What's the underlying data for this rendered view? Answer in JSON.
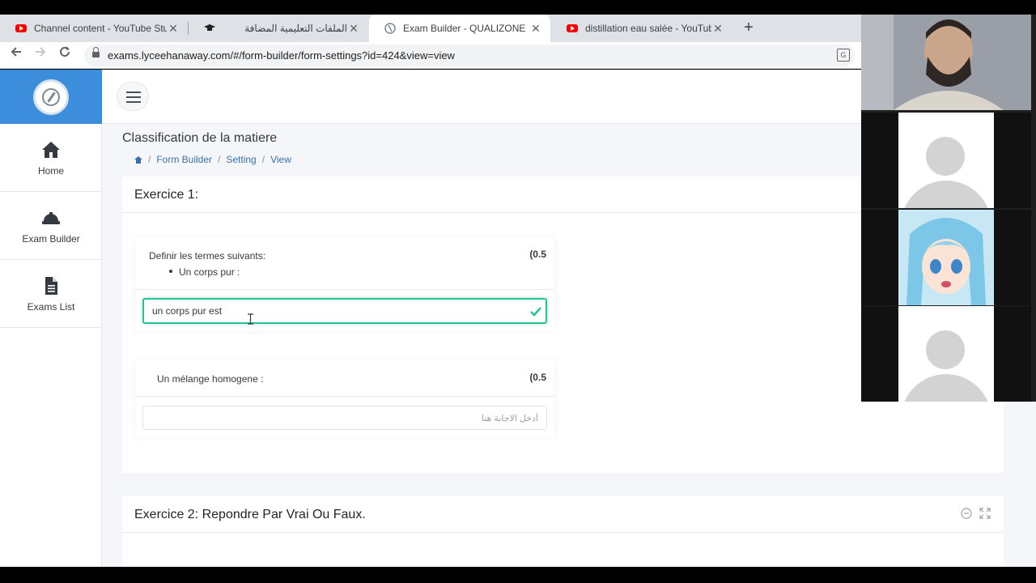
{
  "browser": {
    "tabs": [
      {
        "label": "Channel content - YouTube Studio",
        "icon": "youtube-icon",
        "active": false
      },
      {
        "label": "الملفات التعليمية المضافة",
        "icon": "graduation-cap-icon",
        "active": false
      },
      {
        "label": "Exam Builder - QUALIZONE",
        "icon": "qualizone-icon",
        "active": true
      },
      {
        "label": "distillation eau salée - YouTube",
        "icon": "youtube-icon",
        "active": false
      }
    ],
    "new_tab": "+",
    "url": "exams.lyceehanaway.com/#/form-builder/form-settings?id=424&view=view"
  },
  "sidebar": {
    "items": [
      {
        "label": "Home",
        "icon": "home-icon"
      },
      {
        "label": "Exam Builder",
        "icon": "hard-hat-icon"
      },
      {
        "label": "Exams List",
        "icon": "file-icon"
      }
    ]
  },
  "header": {
    "title": "Classification de la matiere",
    "breadcrumb": [
      "Form Builder",
      "Setting",
      "View"
    ]
  },
  "exercise1": {
    "title": "Exercice 1:",
    "question1": {
      "prompt": "Definir les termes suivants:",
      "bullet": "Un corps pur :",
      "points": "(0.5",
      "answer_value": "un corps pur est"
    },
    "question2": {
      "prompt": "Un mélange homogene :",
      "points": "(0.5",
      "answer_placeholder": "أدخل الاجابة هنا"
    }
  },
  "exercise2": {
    "title": "Exercice 2: Repondre Par Vrai Ou Faux."
  },
  "colors": {
    "brand": "#3c8ddc",
    "valid": "#28c29a",
    "link": "#3c6fa8"
  }
}
